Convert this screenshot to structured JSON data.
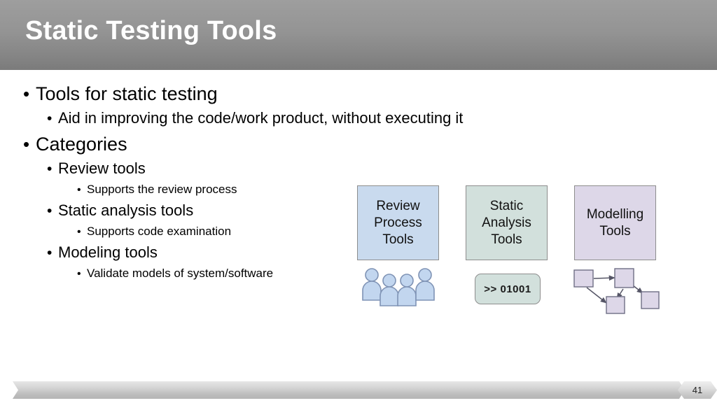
{
  "slide": {
    "title": "Static Testing Tools",
    "number": "41"
  },
  "bullets": [
    {
      "level": 1,
      "marker": "•",
      "text": "Tools for static testing"
    },
    {
      "level": 2,
      "marker": "•",
      "text": "Aid in improving the code/work product, without executing it"
    },
    {
      "level": 1,
      "marker": "•",
      "text": "Categories"
    },
    {
      "level": 2,
      "marker": "•",
      "text": "Review tools"
    },
    {
      "level": 3,
      "marker": "•",
      "text": "Supports the review process"
    },
    {
      "level": 2,
      "marker": "•",
      "text": "Static analysis tools"
    },
    {
      "level": 3,
      "marker": "•",
      "text": "Supports code examination"
    },
    {
      "level": 2,
      "marker": "•",
      "text": "Modeling tools"
    },
    {
      "level": 3,
      "marker": "•",
      "text": "Validate models of system/software"
    }
  ],
  "diagram": {
    "boxes": [
      {
        "id": "review",
        "label": "Review\nProcess\nTools",
        "line1": "Review",
        "line2": "Process",
        "line3": "Tools",
        "fill": "#c9daee",
        "border": "#8d8d8d"
      },
      {
        "id": "static",
        "label": "Static\nAnalysis\nTools",
        "line1": "Static",
        "line2": "Analysis",
        "line3": "Tools",
        "fill": "#d2e0dc",
        "border": "#8d8d8d"
      },
      {
        "id": "model",
        "label": "Modelling\nTools",
        "line1": "Modelling",
        "line2": "Tools",
        "line3": "",
        "fill": "#ddd7e8",
        "border": "#8d8d8d"
      }
    ],
    "icons": {
      "people": {
        "name": "people-group-icon",
        "count": 4,
        "fill": "#c2d6ef",
        "stroke": "#7f93b5"
      },
      "code": {
        "name": "code-chip-icon",
        "text": ">> 01001",
        "fill": "#d2e0dc",
        "stroke": "#8d8d8d"
      },
      "graph": {
        "name": "node-graph-icon",
        "nodes": 4,
        "edges": 4,
        "fill": "#ddd7e8",
        "stroke": "#6f6f85"
      }
    }
  },
  "theme": {
    "title_bar_top": "#9e9e9e",
    "title_bar_bottom": "#7b7b7b",
    "title_color": "#ffffff",
    "body_bg": "#ffffff",
    "text_color": "#000000",
    "footer_bar": "#c9c9c9"
  }
}
